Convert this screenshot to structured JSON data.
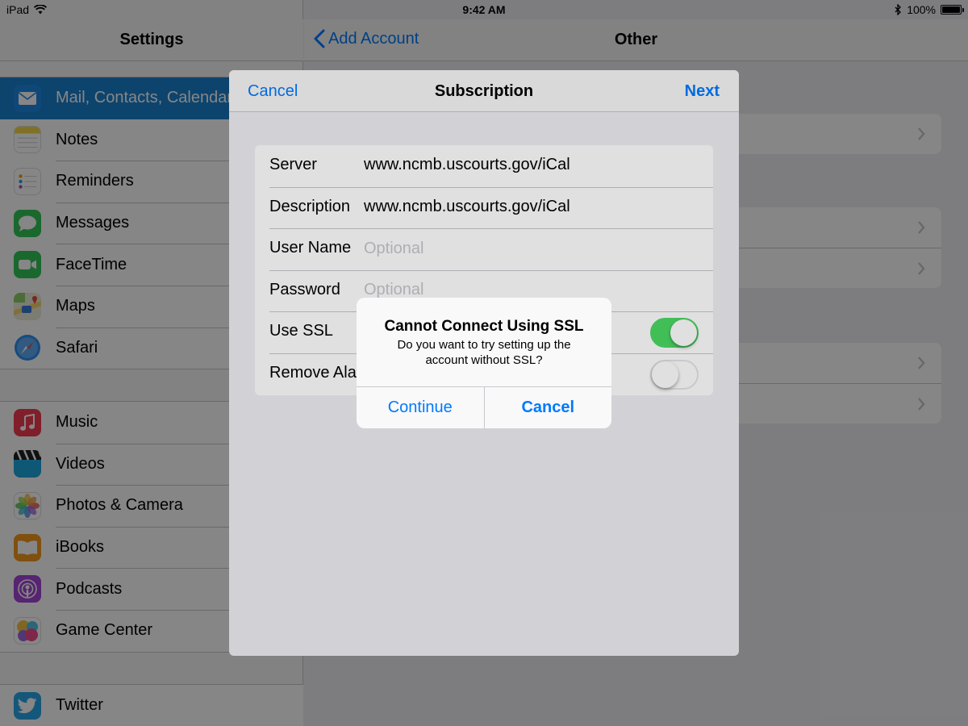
{
  "status_bar": {
    "device": "iPad",
    "time": "9:42 AM",
    "battery": "100%"
  },
  "sidebar": {
    "title": "Settings",
    "groups": [
      [
        {
          "label": "Mail, Contacts, Calendars",
          "icon": "mail-icon",
          "color": "#1e88e5",
          "selected": true
        },
        {
          "label": "Notes",
          "icon": "notes-icon",
          "color": "#f5d74b"
        },
        {
          "label": "Reminders",
          "icon": "reminders-icon",
          "color": "#ffffff"
        },
        {
          "label": "Messages",
          "icon": "messages-icon",
          "color": "#35c759"
        },
        {
          "label": "FaceTime",
          "icon": "facetime-icon",
          "color": "#35c759"
        },
        {
          "label": "Maps",
          "icon": "maps-icon",
          "color": "#8fcf6b"
        },
        {
          "label": "Safari",
          "icon": "safari-icon",
          "color": "#2e8ff0"
        }
      ],
      [
        {
          "label": "Music",
          "icon": "music-icon",
          "color": "#f33b4f"
        },
        {
          "label": "Videos",
          "icon": "videos-icon",
          "color": "#1ca6e0"
        },
        {
          "label": "Photos & Camera",
          "icon": "photos-icon",
          "color": "#ffffff"
        },
        {
          "label": "iBooks",
          "icon": "ibooks-icon",
          "color": "#f49a1e"
        },
        {
          "label": "Podcasts",
          "icon": "podcasts-icon",
          "color": "#a445d8"
        },
        {
          "label": "Game Center",
          "icon": "game-center-icon",
          "color": "#ffffff"
        }
      ],
      [
        {
          "label": "Twitter",
          "icon": "twitter-icon",
          "color": "#2aa5e8"
        }
      ]
    ]
  },
  "detail": {
    "back_label": "Add Account",
    "title": "Other"
  },
  "modal": {
    "cancel_label": "Cancel",
    "title": "Subscription",
    "next_label": "Next",
    "fields": {
      "server": {
        "label": "Server",
        "value": "www.ncmb.uscourts.gov/iCal"
      },
      "description": {
        "label": "Description",
        "value": "www.ncmb.uscourts.gov/iCal"
      },
      "username": {
        "label": "User Name",
        "placeholder": "Optional",
        "value": ""
      },
      "password": {
        "label": "Password",
        "placeholder": "Optional",
        "value": ""
      },
      "use_ssl": {
        "label": "Use SSL",
        "on": true
      },
      "remove_alarms": {
        "label": "Remove Alarms",
        "on": false
      }
    }
  },
  "alert": {
    "title": "Cannot Connect Using SSL",
    "message": "Do you want to try setting up the account without SSL?",
    "continue_label": "Continue",
    "cancel_label": "Cancel"
  },
  "colors": {
    "accent": "#007aff",
    "selected_row": "#1982d1",
    "toggle_on": "#4cd964"
  }
}
